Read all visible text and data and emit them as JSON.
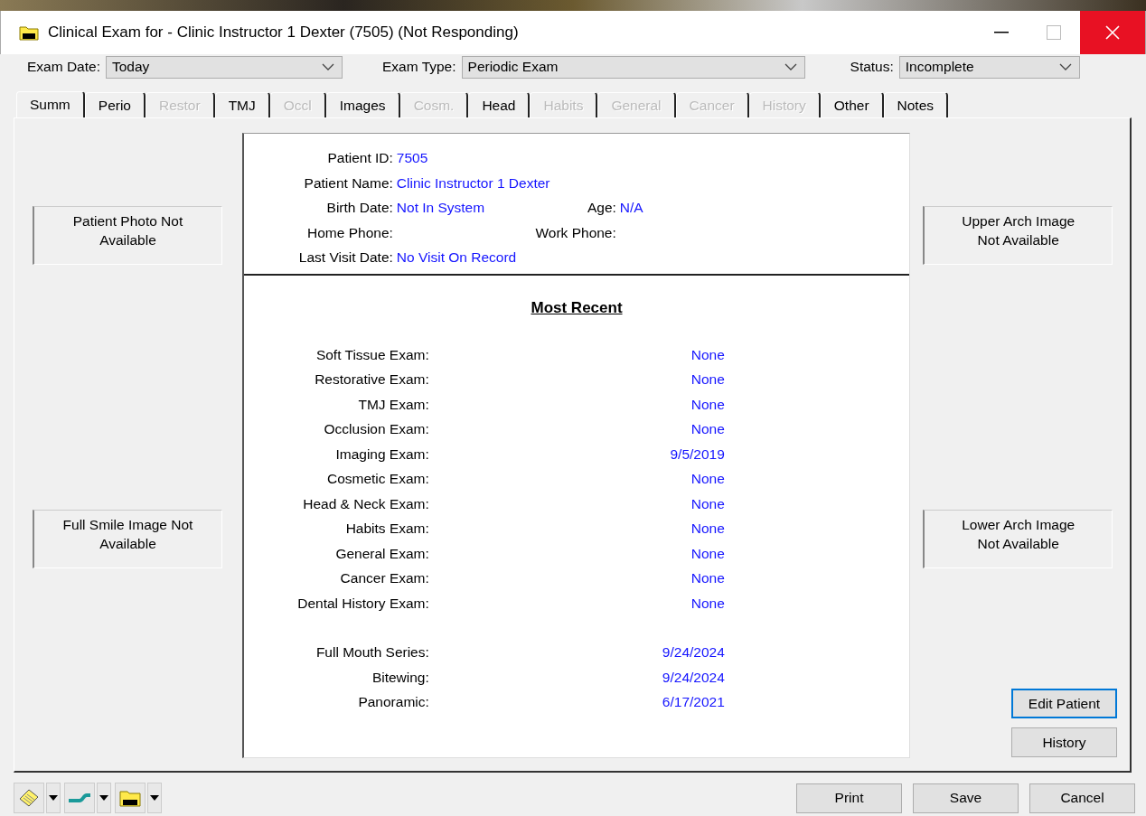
{
  "window": {
    "title": "Clinical Exam for - Clinic Instructor 1 Dexter (7505) (Not Responding)"
  },
  "header_fields": [
    {
      "label": "Exam Date:",
      "value": "Today"
    },
    {
      "label": "Exam Type:",
      "value": "Periodic Exam"
    },
    {
      "label": "Status:",
      "value": "Incomplete"
    }
  ],
  "tabs": [
    {
      "label": "Summ",
      "selected": true,
      "disabled": false
    },
    {
      "label": "Perio",
      "selected": false,
      "disabled": false
    },
    {
      "label": "Restor",
      "selected": false,
      "disabled": true
    },
    {
      "label": "TMJ",
      "selected": false,
      "disabled": false
    },
    {
      "label": "Occl",
      "selected": false,
      "disabled": true
    },
    {
      "label": "Images",
      "selected": false,
      "disabled": false
    },
    {
      "label": "Cosm.",
      "selected": false,
      "disabled": true
    },
    {
      "label": "Head",
      "selected": false,
      "disabled": false
    },
    {
      "label": "Habits",
      "selected": false,
      "disabled": true
    },
    {
      "label": "General",
      "selected": false,
      "disabled": true
    },
    {
      "label": "Cancer",
      "selected": false,
      "disabled": true
    },
    {
      "label": "History",
      "selected": false,
      "disabled": true
    },
    {
      "label": "Other",
      "selected": false,
      "disabled": false
    },
    {
      "label": "Notes",
      "selected": false,
      "disabled": false
    }
  ],
  "left_images": [
    "Patient Photo Not Available",
    "Full Smile Image Not Available"
  ],
  "right_images": [
    "Upper Arch Image Not Available",
    "Lower Arch Image Not Available"
  ],
  "patient_info": [
    [
      {
        "label": "Patient ID:",
        "value": "7505"
      }
    ],
    [
      {
        "label": "Patient Name:",
        "value": "Clinic Instructor 1 Dexter"
      }
    ],
    [
      {
        "label": "Birth Date:",
        "value": "Not In System"
      },
      {
        "label": "Age:",
        "value": "N/A"
      }
    ],
    [
      {
        "label": "Home Phone:"
      },
      {
        "label": "Work Phone:"
      }
    ],
    [
      {
        "label": "Last Visit Date:",
        "value": "No Visit On Record"
      }
    ]
  ],
  "most_recent": {
    "title": "Most Recent",
    "groups": [
      [
        {
          "label": "Soft Tissue Exam:",
          "value": "None"
        },
        {
          "label": "Restorative Exam:",
          "value": "None"
        },
        {
          "label": "TMJ Exam:",
          "value": "None"
        },
        {
          "label": "Occlusion Exam:",
          "value": "None"
        },
        {
          "label": "Imaging Exam:",
          "value": "9/5/2019"
        },
        {
          "label": "Cosmetic Exam:",
          "value": "None"
        },
        {
          "label": "Head & Neck Exam:",
          "value": "None"
        },
        {
          "label": "Habits Exam:",
          "value": "None"
        },
        {
          "label": "General Exam:",
          "value": "None"
        },
        {
          "label": "Cancer Exam:",
          "value": "None"
        },
        {
          "label": "Dental History Exam:",
          "value": "None"
        }
      ],
      [
        {
          "label": "Full Mouth Series:",
          "value": "9/24/2024"
        },
        {
          "label": "Bitewing:",
          "value": "9/24/2024"
        },
        {
          "label": "Panoramic:",
          "value": "6/17/2021"
        }
      ]
    ]
  },
  "side_buttons": [
    {
      "label": "Edit Patient",
      "focused": true
    },
    {
      "label": "History",
      "focused": false
    }
  ],
  "footer_buttons": [
    "Print",
    "Save",
    "Cancel"
  ]
}
